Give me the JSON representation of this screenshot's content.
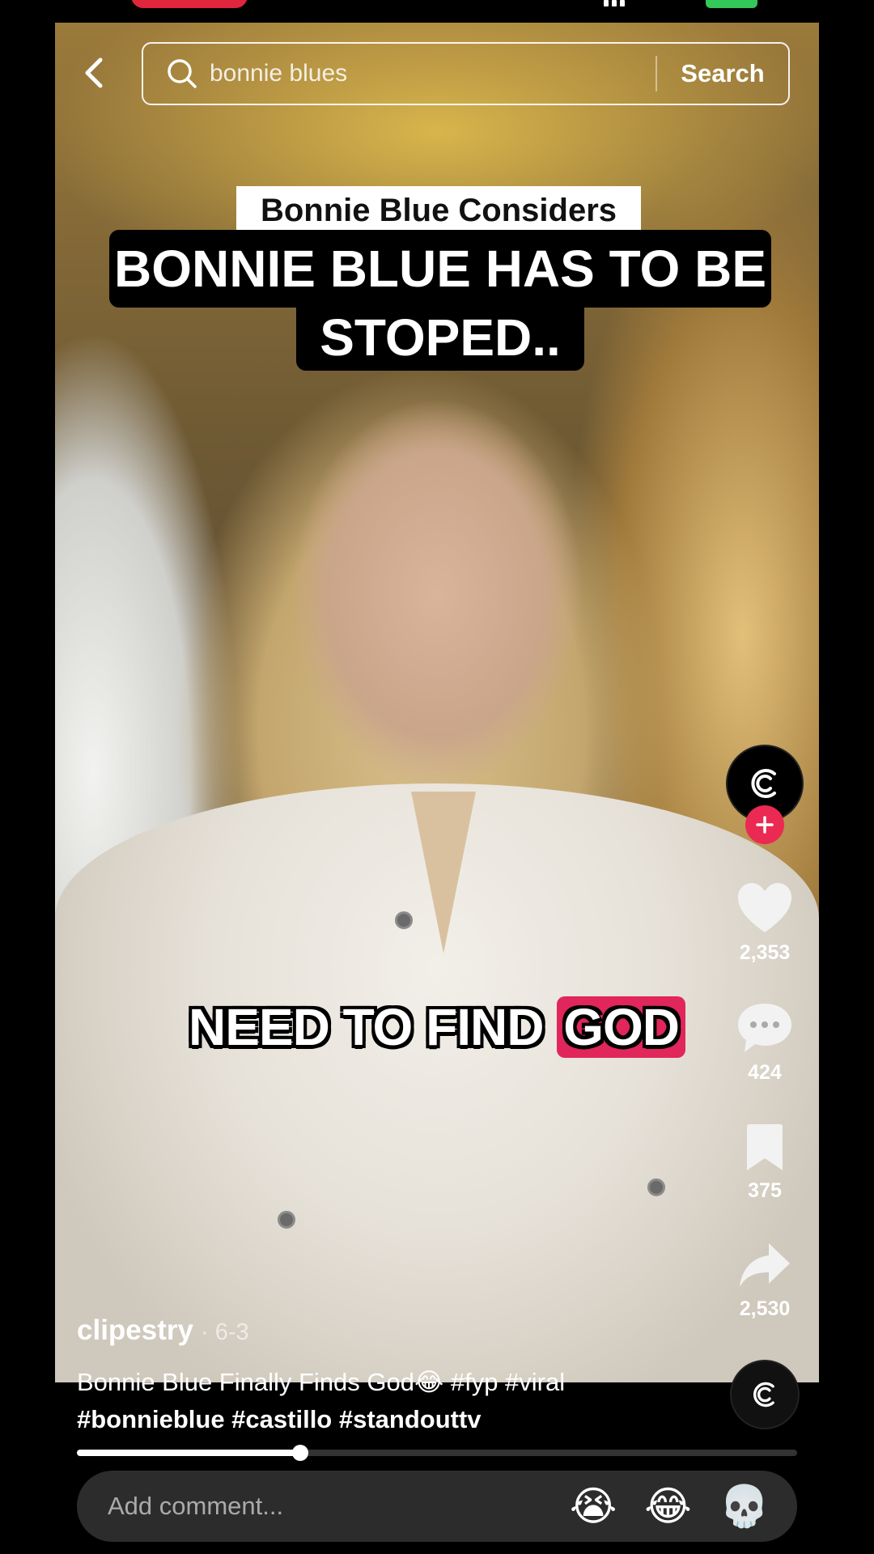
{
  "search": {
    "query": "bonnie blues",
    "button_label": "Search"
  },
  "video": {
    "caption_top": "Bonnie Blue Considers",
    "caption_line1": "BONNIE BLUE HAS TO BE",
    "caption_line2": "STOPED..",
    "subtitle_plain": "NEED TO FIND",
    "subtitle_highlight": "GOD",
    "highlight_color": "#e0265a"
  },
  "rail": {
    "likes": "2,353",
    "comments": "424",
    "saves": "375",
    "shares": "2,530",
    "accent_color": "#ea2a52"
  },
  "post": {
    "username": "clipestry",
    "date": "· 6-3",
    "description_line1": "Bonnie Blue Finally Finds God😂 #fyp #viral",
    "description_line2": "#bonnieblue #castillo #standouttv"
  },
  "playback": {
    "progress": 0.31
  },
  "comment": {
    "placeholder": "Add comment...",
    "emojis": [
      "😭",
      "😂",
      "💀"
    ]
  }
}
